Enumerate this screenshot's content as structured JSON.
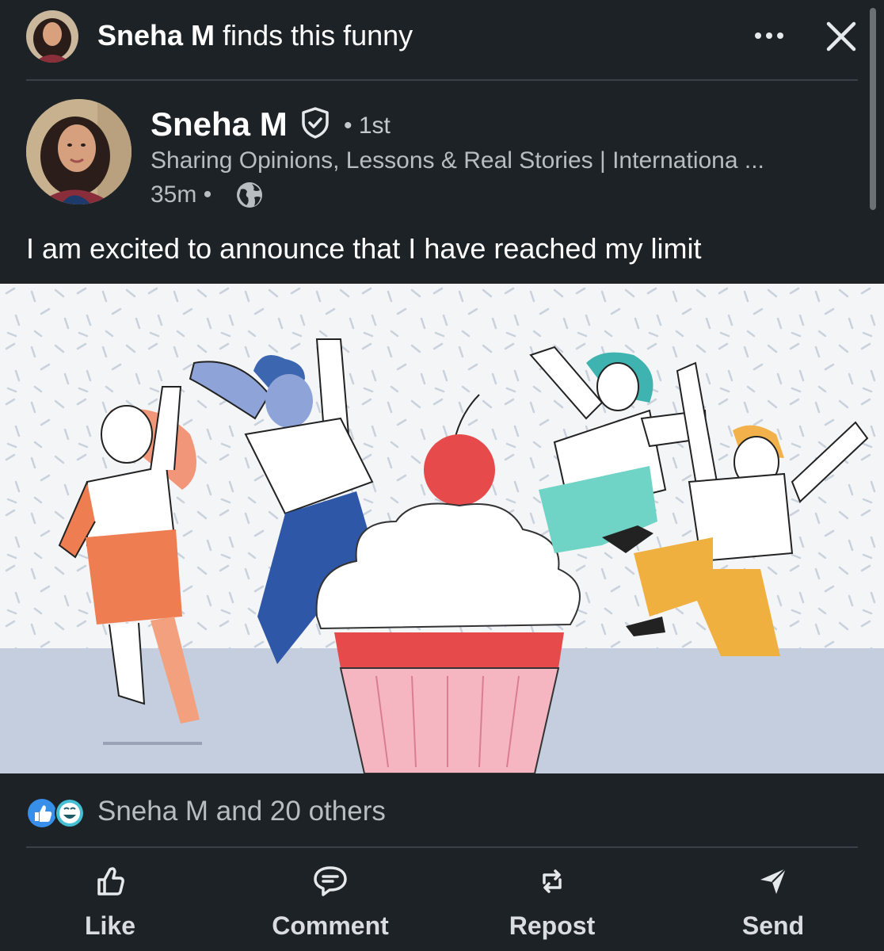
{
  "activity": {
    "actor": "Sneha M",
    "action": "finds this funny"
  },
  "post": {
    "author": "Sneha M",
    "degree": "• 1st",
    "headline": "Sharing Opinions, Lessons & Real Stories | Internationa ...",
    "time": "35m •",
    "text": "I am excited to announce that I have reached my limit"
  },
  "social": {
    "reactions_text": "Sneha M and 20 others"
  },
  "actions": {
    "like": "Like",
    "comment": "Comment",
    "repost": "Repost",
    "send": "Send"
  },
  "icons": [
    "more-icon",
    "close-icon",
    "verified-icon",
    "globe-icon",
    "like-reaction-icon",
    "funny-reaction-icon",
    "like-icon",
    "comment-icon",
    "repost-icon",
    "send-icon"
  ],
  "colors": {
    "background": "#1d2226",
    "text_primary": "#ffffff",
    "text_secondary": "#b8bdc2",
    "like_blue": "#378fe9",
    "funny_teal": "#44bfd3"
  }
}
